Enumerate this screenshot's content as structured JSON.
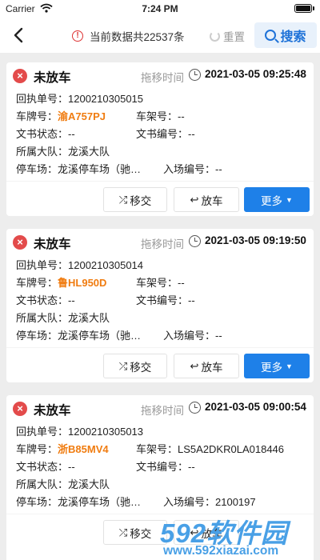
{
  "statusbar": {
    "carrier": "Carrier",
    "time": "7:24 PM"
  },
  "header": {
    "count_text": "当前数据共22537条",
    "reset_label": "重置",
    "search_label": "搜索"
  },
  "labels": {
    "receipt_no": "回执单号：",
    "plate": "车牌号：",
    "frame": "车架号：",
    "doc_status": "文书状态：",
    "doc_no": "文书编号：",
    "brigade": "所属大队：",
    "lot": "停车场：",
    "entry_no": "入场编号：",
    "move_time": "拖移时间"
  },
  "buttons": {
    "move": "移交",
    "release": "放车",
    "more": "更多"
  },
  "records": [
    {
      "status": "未放车",
      "move_time": "2021-03-05 09:25:48",
      "receipt_no": "1200210305015",
      "plate": "渝A757PJ",
      "frame": "--",
      "doc_status": "--",
      "doc_no": "--",
      "brigade": "龙溪大队",
      "lot": "龙溪停车场（驰…",
      "entry_no": "--"
    },
    {
      "status": "未放车",
      "move_time": "2021-03-05 09:19:50",
      "receipt_no": "1200210305014",
      "plate": "鲁HL950D",
      "frame": "--",
      "doc_status": "--",
      "doc_no": "--",
      "brigade": "龙溪大队",
      "lot": "龙溪停车场（驰…",
      "entry_no": "--"
    },
    {
      "status": "未放车",
      "move_time": "2021-03-05 09:00:54",
      "receipt_no": "1200210305013",
      "plate": "浙B85MV4",
      "frame": "LS5A2DKR0LA018446",
      "doc_status": "--",
      "doc_no": "--",
      "brigade": "龙溪大队",
      "lot": "龙溪停车场（驰…",
      "entry_no": "2100197"
    }
  ],
  "watermark": {
    "brand": "592软件园",
    "url": "www.592xiazai.com"
  },
  "colors": {
    "accent": "#1e80e8",
    "plate": "#f07c10",
    "status_icon": "#e34b4b"
  }
}
